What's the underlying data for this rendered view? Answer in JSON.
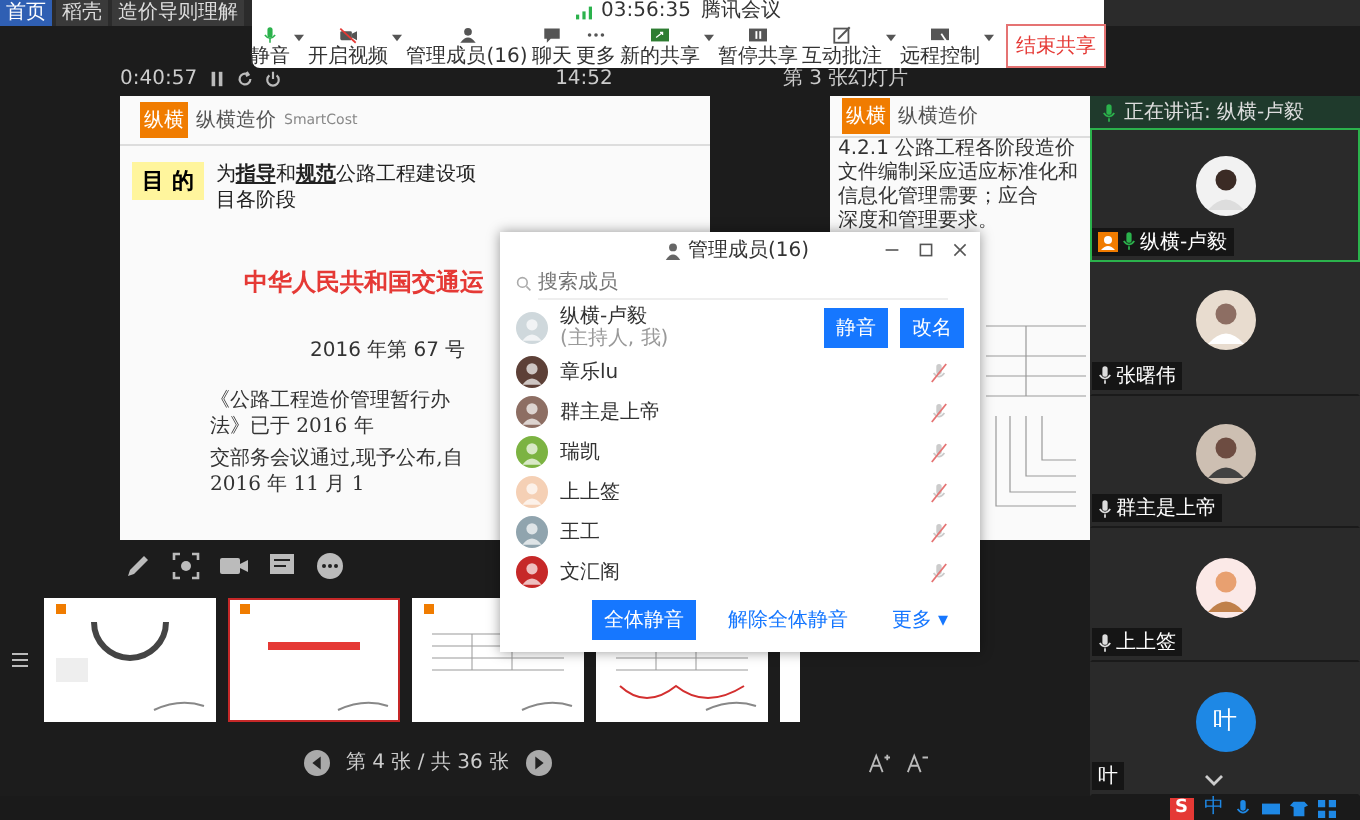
{
  "browser_tabs": [
    {
      "label": "首页",
      "selected": true
    },
    {
      "label": "稻壳",
      "selected": false
    },
    {
      "label": "造价导则理解",
      "selected": false
    }
  ],
  "meeting_toolbar": {
    "clock": "03:56:35",
    "title": "腾讯会议",
    "buttons": [
      {
        "label": "静音",
        "menu": true
      },
      {
        "label": "开启视频",
        "menu": true
      },
      {
        "label": "管理成员(16)",
        "menu": false
      },
      {
        "label": "聊天",
        "menu": false
      },
      {
        "label": "更多",
        "menu": false
      },
      {
        "label": "新的共享",
        "menu": true
      },
      {
        "label": "暂停共享",
        "menu": false
      },
      {
        "label": "互动批注",
        "menu": true
      },
      {
        "label": "远程控制",
        "menu": true
      }
    ],
    "end_button": "结束共享"
  },
  "share_info": {
    "elapsed": "0:40:57",
    "clock": "14:52",
    "caption": "第 3 张幻灯片"
  },
  "left_slide": {
    "logo": "纵横",
    "brand": "纵横造价",
    "brand_sub": "SmartCost",
    "tag": "目 的",
    "intro": "为**指导**和**规范**公路工程建设项目各阶段",
    "headline": "中华人民共和国交通运",
    "number": "2016 年第 67 号",
    "body": [
      "《公路工程造价管理暂行办法》已于 2016 年",
      "交部务会议通过,现予公布,自 2016 年 11 月 1"
    ]
  },
  "right_slide": {
    "logo": "纵横",
    "brand": "纵横造价",
    "text": "4.2.1 公路工程各阶段造价文件编制采应适应标准化和信息化管理需要；应合",
    "text2": "深度和管理要求。"
  },
  "thumbnails": [
    {
      "selected": false
    },
    {
      "selected": true
    },
    {
      "selected": false
    },
    {
      "selected": false
    },
    {
      "selected": false
    }
  ],
  "slide_nav": "第 4 张 / 共 36 张",
  "member_panel": {
    "title": "管理成员(16)",
    "search": {
      "placeholder": "搜索成员"
    },
    "members": [
      {
        "name": "纵横-卢毅",
        "role": "(主持人, 我)",
        "actions": [
          "静音",
          "改名"
        ],
        "muted": false
      },
      {
        "name": "章乐lu",
        "muted": true
      },
      {
        "name": "群主是上帝",
        "muted": true
      },
      {
        "name": "瑞凯",
        "muted": true
      },
      {
        "name": "上上签",
        "muted": true
      },
      {
        "name": "王工",
        "muted": true
      },
      {
        "name": "文汇阁",
        "muted": true
      }
    ],
    "footer": {
      "primary": "全体静音",
      "secondary": "解除全体静音",
      "more": "更多 ▾"
    }
  },
  "video_panel": {
    "speaking": "正在讲话: 纵横-卢毅",
    "participants": [
      {
        "name": "纵横-卢毅",
        "host": true,
        "speaking": true
      },
      {
        "name": "张曙伟",
        "host": false,
        "speaking": false
      },
      {
        "name": "群主是上帝",
        "host": false,
        "speaking": false
      },
      {
        "name": "上上签",
        "host": false,
        "speaking": false
      },
      {
        "name": "叶",
        "host": false,
        "speaking": false,
        "letter": "叶"
      }
    ]
  },
  "taskbar": {
    "ime_logo": "S",
    "ime": "中"
  }
}
